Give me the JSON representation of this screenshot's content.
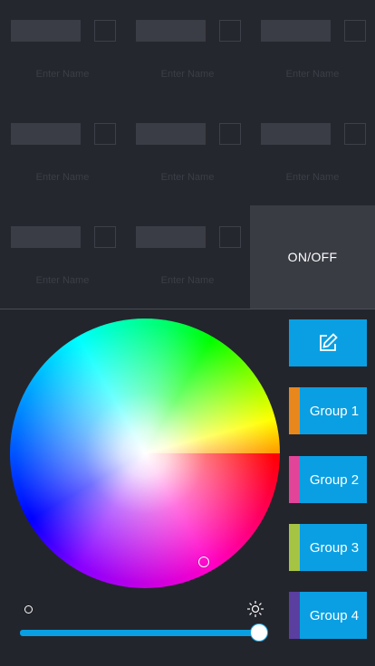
{
  "zones": {
    "name_placeholder": "Enter Name",
    "onoff_label": "ON/OFF"
  },
  "groups": [
    {
      "label": "Group 1",
      "color": "#e8871c"
    },
    {
      "label": "Group 2",
      "color": "#e2449a"
    },
    {
      "label": "Group 3",
      "color": "#a6c444"
    },
    {
      "label": "Group 4",
      "color": "#5a3fa0"
    }
  ],
  "icons": {
    "edit": "edit-icon",
    "brightness_low": "brightness-low-icon",
    "brightness_high": "brightness-high-icon"
  },
  "colors": {
    "accent": "#0a9fe2",
    "background": "#23252c"
  },
  "brightness": {
    "value_fraction": 0.98
  }
}
